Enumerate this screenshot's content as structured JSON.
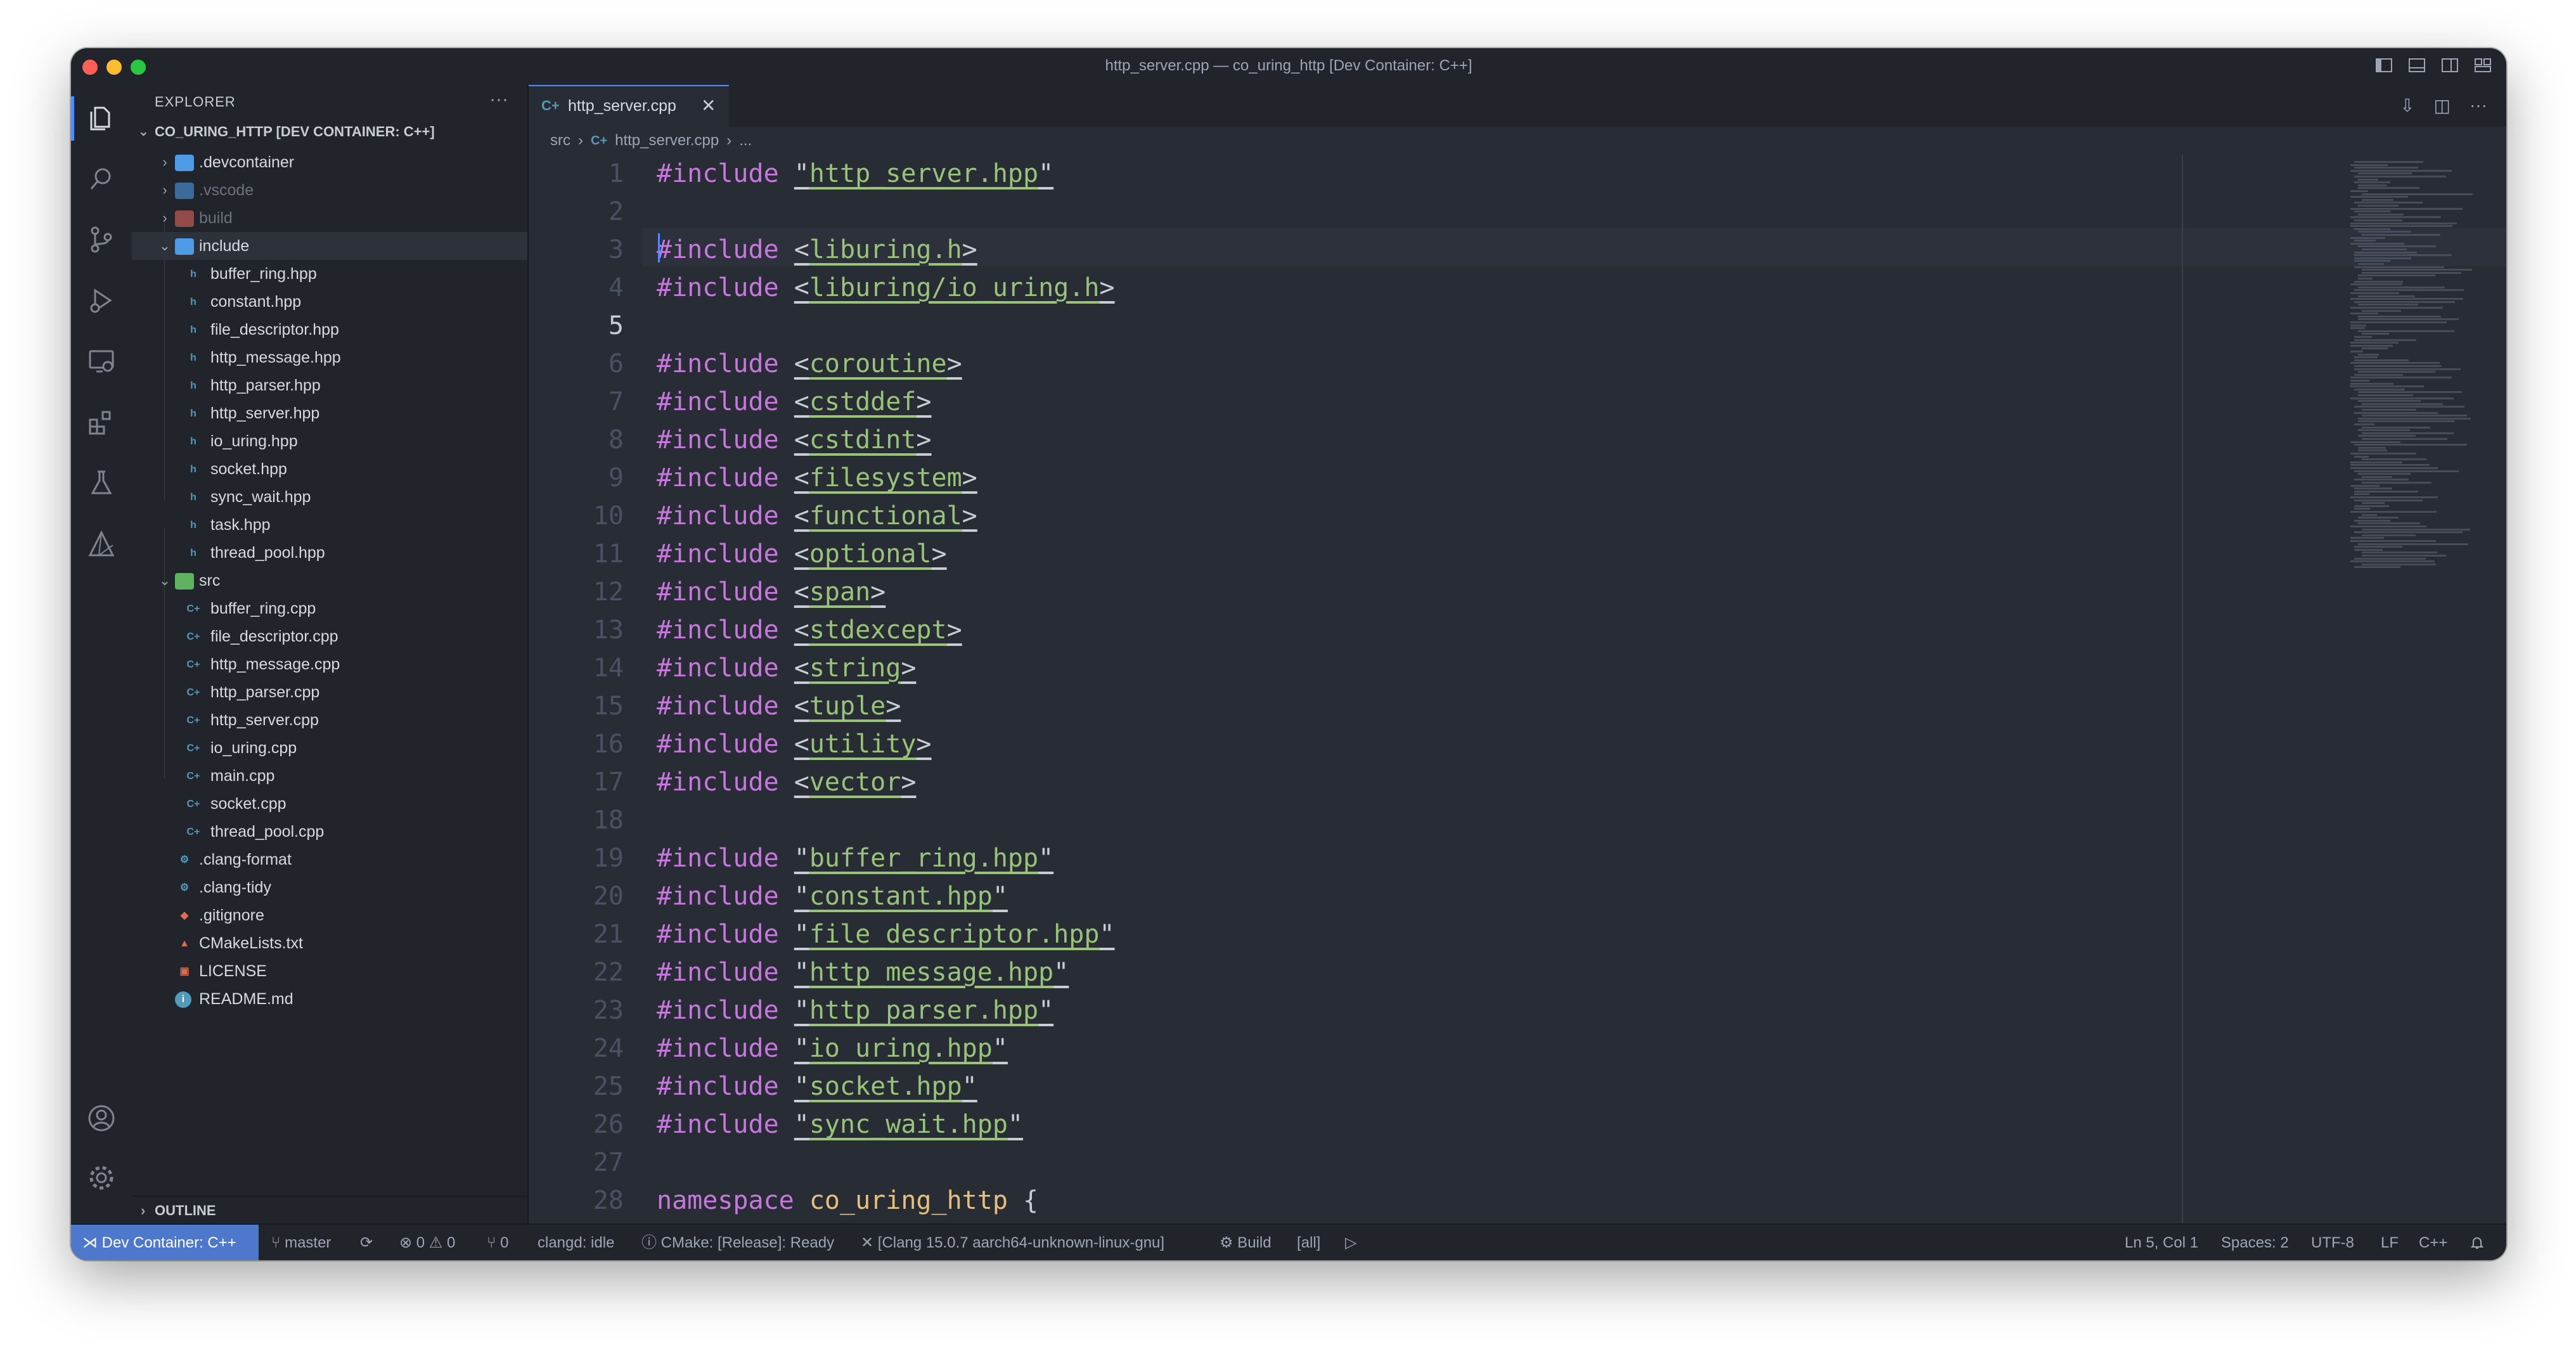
{
  "window": {
    "title": "http_server.cpp — co_uring_http [Dev Container: C++]"
  },
  "activity_bar": [
    "explorer-icon",
    "search-icon",
    "source-control-icon",
    "run-debug-icon",
    "remote-explorer-icon",
    "extensions-icon",
    "testing-icon",
    "cmake-icon",
    "account-icon",
    "settings-gear-icon"
  ],
  "sidebar": {
    "header": "EXPLORER",
    "more": "···",
    "root": "CO_URING_HTTP [DEV CONTAINER: C++]",
    "items": [
      {
        "label": ".devcontainer",
        "type": "folder"
      },
      {
        "label": ".vscode",
        "type": "folder"
      },
      {
        "label": "build",
        "type": "folder"
      },
      {
        "label": "include",
        "type": "folder"
      },
      {
        "label": "buffer_ring.hpp",
        "type": "hpp"
      },
      {
        "label": "constant.hpp",
        "type": "hpp"
      },
      {
        "label": "file_descriptor.hpp",
        "type": "hpp"
      },
      {
        "label": "http_message.hpp",
        "type": "hpp"
      },
      {
        "label": "http_parser.hpp",
        "type": "hpp"
      },
      {
        "label": "http_server.hpp",
        "type": "hpp"
      },
      {
        "label": "io_uring.hpp",
        "type": "hpp"
      },
      {
        "label": "socket.hpp",
        "type": "hpp"
      },
      {
        "label": "sync_wait.hpp",
        "type": "hpp"
      },
      {
        "label": "task.hpp",
        "type": "hpp"
      },
      {
        "label": "thread_pool.hpp",
        "type": "hpp"
      },
      {
        "label": "src",
        "type": "folder"
      },
      {
        "label": "buffer_ring.cpp",
        "type": "cpp"
      },
      {
        "label": "file_descriptor.cpp",
        "type": "cpp"
      },
      {
        "label": "http_message.cpp",
        "type": "cpp"
      },
      {
        "label": "http_parser.cpp",
        "type": "cpp"
      },
      {
        "label": "http_server.cpp",
        "type": "cpp"
      },
      {
        "label": "io_uring.cpp",
        "type": "cpp"
      },
      {
        "label": "main.cpp",
        "type": "cpp"
      },
      {
        "label": "socket.cpp",
        "type": "cpp"
      },
      {
        "label": "thread_pool.cpp",
        "type": "cpp"
      },
      {
        "label": ".clang-format",
        "type": "gear"
      },
      {
        "label": ".clang-tidy",
        "type": "gear"
      },
      {
        "label": ".gitignore",
        "type": "git"
      },
      {
        "label": "CMakeLists.txt",
        "type": "cmake"
      },
      {
        "label": "LICENSE",
        "type": "license"
      },
      {
        "label": "README.md",
        "type": "info"
      }
    ],
    "outline": "OUTLINE"
  },
  "editor": {
    "tab": {
      "label": "http_server.cpp",
      "icon": "C+",
      "close": "✕"
    },
    "breadcrumb": {
      "folder": "src",
      "icon": "C+",
      "file": "http_server.cpp",
      "more": "..."
    },
    "active_line": "5",
    "lines": [
      {
        "n": "1",
        "kind": "quote",
        "path": "http_server.hpp"
      },
      {
        "n": "2",
        "kind": "blank"
      },
      {
        "n": "3",
        "kind": "angle",
        "path": "liburing.h"
      },
      {
        "n": "4",
        "kind": "angle",
        "path": "liburing/io_uring.h"
      },
      {
        "n": "5",
        "kind": "blank"
      },
      {
        "n": "6",
        "kind": "angle",
        "path": "coroutine"
      },
      {
        "n": "7",
        "kind": "angle",
        "path": "cstddef"
      },
      {
        "n": "8",
        "kind": "angle",
        "path": "cstdint"
      },
      {
        "n": "9",
        "kind": "angle",
        "path": "filesystem"
      },
      {
        "n": "10",
        "kind": "angle",
        "path": "functional"
      },
      {
        "n": "11",
        "kind": "angle",
        "path": "optional"
      },
      {
        "n": "12",
        "kind": "angle",
        "path": "span"
      },
      {
        "n": "13",
        "kind": "angle",
        "path": "stdexcept"
      },
      {
        "n": "14",
        "kind": "angle",
        "path": "string"
      },
      {
        "n": "15",
        "kind": "angle",
        "path": "tuple"
      },
      {
        "n": "16",
        "kind": "angle",
        "path": "utility"
      },
      {
        "n": "17",
        "kind": "angle",
        "path": "vector"
      },
      {
        "n": "18",
        "kind": "blank"
      },
      {
        "n": "19",
        "kind": "quote",
        "path": "buffer_ring.hpp"
      },
      {
        "n": "20",
        "kind": "quote",
        "path": "constant.hpp"
      },
      {
        "n": "21",
        "kind": "quote",
        "path": "file_descriptor.hpp"
      },
      {
        "n": "22",
        "kind": "quote",
        "path": "http_message.hpp"
      },
      {
        "n": "23",
        "kind": "quote",
        "path": "http_parser.hpp"
      },
      {
        "n": "24",
        "kind": "quote",
        "path": "io_uring.hpp"
      },
      {
        "n": "25",
        "kind": "quote",
        "path": "socket.hpp"
      },
      {
        "n": "26",
        "kind": "quote",
        "path": "sync_wait.hpp"
      },
      {
        "n": "27",
        "kind": "blank"
      },
      {
        "n": "28",
        "kind": "namespace",
        "keyword": "namespace",
        "name": "co_uring_http",
        "brace": "{"
      }
    ],
    "include_keyword": "#include"
  },
  "statusbar": {
    "remote": "Dev Container: C++",
    "branch": "master",
    "sync": "⟳",
    "problems": "⊗ 0 ⚠ 0",
    "ports": "⑂ 0",
    "clangd": "clangd: idle",
    "cmake": "ⓘ CMake: [Release]: Ready",
    "kit": "✕ [Clang 15.0.7 aarch64-unknown-linux-gnu]",
    "build": "⚙ Build",
    "target": "[all]",
    "run": "▷",
    "position": "Ln 5, Col 1",
    "spaces": "Spaces: 2",
    "encoding": "UTF-8",
    "eol": "LF",
    "language": "C++",
    "bell": "🔔"
  },
  "colors": {
    "accent": "#528bff",
    "remote": "#4d78cc",
    "background": "#282c34",
    "sidebar": "#21252b",
    "string": "#98c379",
    "keyword": "#c678dd"
  }
}
